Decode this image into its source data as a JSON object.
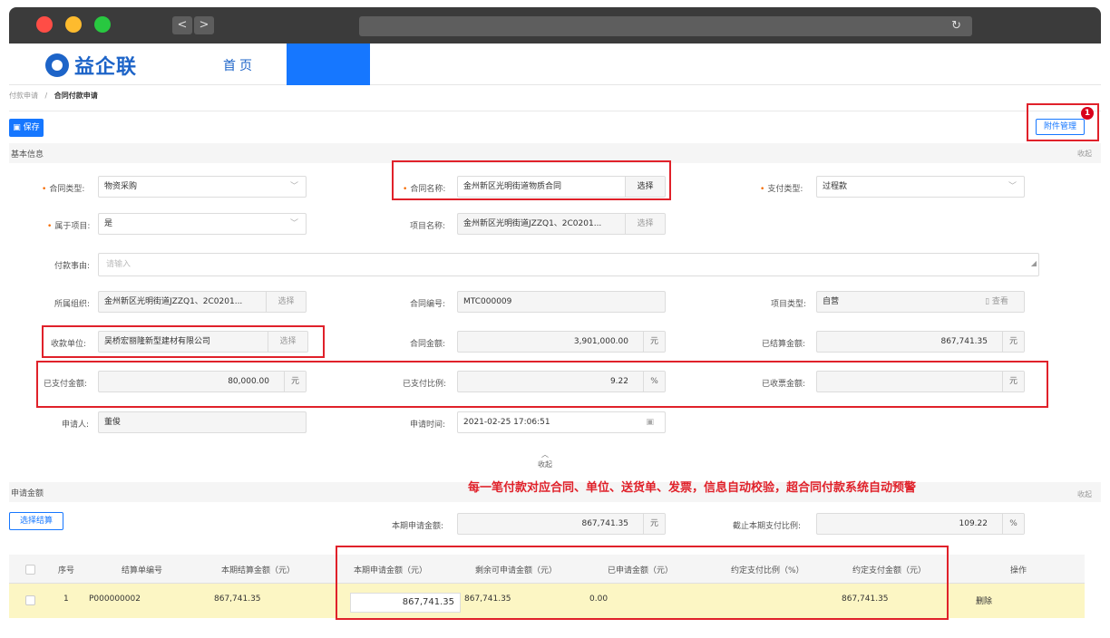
{
  "browser": {
    "back": "<",
    "forward": ">",
    "reload": "↻"
  },
  "header": {
    "logo_text": "益企联",
    "nav_home": "首页"
  },
  "breadcrumb": {
    "parent": "付款申请",
    "sep": "/",
    "current": "合同付款申请"
  },
  "toolbar": {
    "save": "保存",
    "attach": "附件管理",
    "attach_badge": "1"
  },
  "basic_section": {
    "title": "基本信息",
    "collapse": "收起"
  },
  "form": {
    "contract_type": {
      "label": "合同类型:",
      "value": "物资采购"
    },
    "contract_name": {
      "label": "合同名称:",
      "value": "金州新区光明街道物质合同",
      "button": "选择"
    },
    "pay_type": {
      "label": "支付类型:",
      "value": "过程款"
    },
    "belongs_project": {
      "label": "属于项目:",
      "value": "是"
    },
    "project_name": {
      "label": "项目名称:",
      "value": "金州新区光明街道JZZQ1、2C0201...",
      "button": "选择"
    },
    "pay_reason": {
      "label": "付款事由:",
      "placeholder": "请输入"
    },
    "org": {
      "label": "所属组织:",
      "value": "金州新区光明街道JZZQ1、2C0201...",
      "button": "选择"
    },
    "contract_no": {
      "label": "合同编号:",
      "value": "MTC000009"
    },
    "project_type": {
      "label": "项目类型:",
      "value": "自营",
      "button": "查看"
    },
    "payee": {
      "label": "收款单位:",
      "value": "吴桥宏丽隆新型建材有限公司",
      "button": "选择"
    },
    "contract_amount": {
      "label": "合同金额:",
      "value": "3,901,000.00",
      "unit": "元"
    },
    "settled_amount": {
      "label": "已结算金额:",
      "value": "867,741.35",
      "unit": "元"
    },
    "paid_amount": {
      "label": "已支付金额:",
      "value": "80,000.00",
      "unit": "元"
    },
    "paid_ratio": {
      "label": "已支付比例:",
      "value": "9.22",
      "unit": "%"
    },
    "invoiced_amount": {
      "label": "已收票金额:",
      "value": "",
      "unit": "元"
    },
    "applicant": {
      "label": "申请人:",
      "value": "董俊"
    },
    "apply_time": {
      "label": "申请时间:",
      "value": "2021-02-25 17:06:51"
    },
    "collapse_ctl": "收起"
  },
  "apply_section": {
    "title": "申请金额",
    "collapse": "收起"
  },
  "note": "每一笔付款对应合同、单位、送货单、发票，信息自动校验，超合同付款系统自动预警",
  "apply": {
    "select_btn": "选择结算",
    "current_amount": {
      "label": "本期申请金额:",
      "value": "867,741.35",
      "unit": "元"
    },
    "cum_ratio": {
      "label": "截止本期支付比例:",
      "value": "109.22",
      "unit": "%"
    }
  },
  "table": {
    "headers": [
      "序号",
      "结算单编号",
      "本期结算金额（元）",
      "本期申请金额（元）",
      "剩余可申请金额（元）",
      "已申请金额（元）",
      "约定支付比例（%）",
      "约定支付金额（元）",
      "操作"
    ],
    "rows": [
      {
        "idx": "1",
        "no": "P000000002",
        "settle": "867,741.35",
        "apply": "867,741.35",
        "remain": "867,741.35",
        "applied": "0.00",
        "ratio": "",
        "agreed": "867,741.35",
        "action": "删除"
      }
    ]
  }
}
